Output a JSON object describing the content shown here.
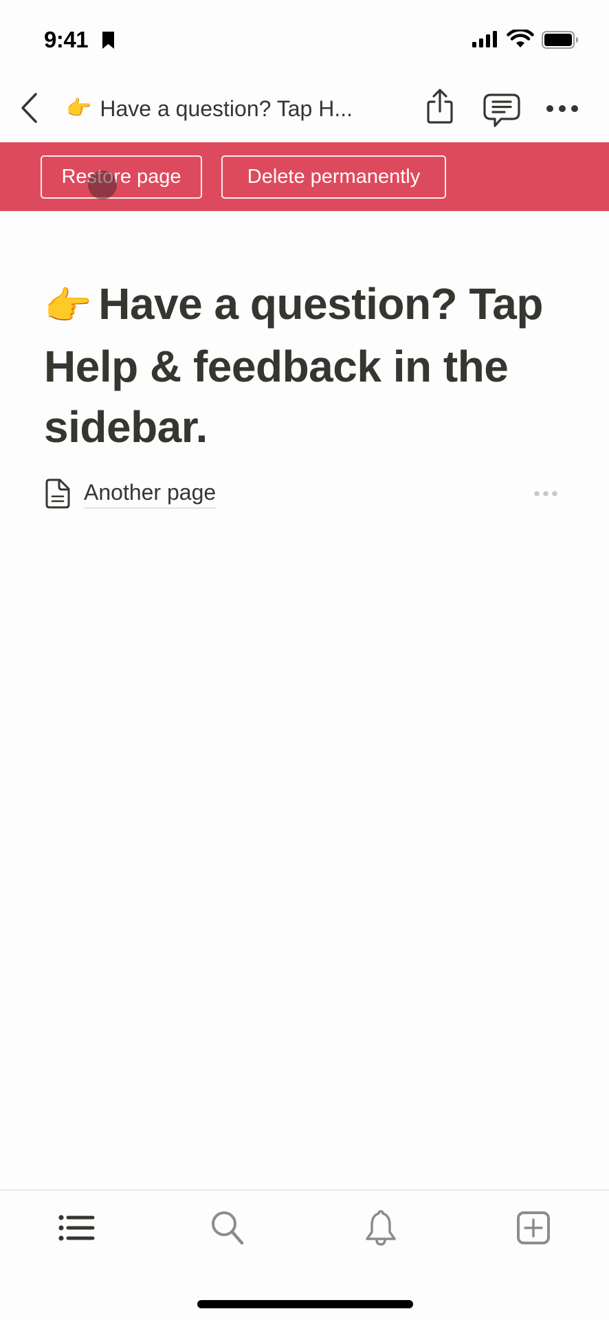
{
  "status_bar": {
    "time": "9:41",
    "icons": [
      "bookmark-icon",
      "cellular-signal-icon",
      "wifi-icon",
      "battery-icon"
    ]
  },
  "nav": {
    "back_icon": "chevron-left-icon",
    "page_emoji": "👉",
    "page_title_truncated": "Have a question? Tap H...",
    "actions": [
      "share-icon",
      "comment-icon",
      "more-horizontal-icon"
    ]
  },
  "trash_banner": {
    "background_color": "#de4a5d",
    "restore_label": "Restore page",
    "delete_label": "Delete permanently"
  },
  "page": {
    "emoji": "👉",
    "title": "Have a question? Tap Help & feedback in the sidebar.",
    "blocks": [
      {
        "type": "page-link",
        "icon": "document-icon",
        "label": "Another page"
      }
    ]
  },
  "tab_bar": {
    "tabs": [
      {
        "name": "sidebar",
        "icon": "list-icon"
      },
      {
        "name": "search",
        "icon": "search-icon"
      },
      {
        "name": "updates",
        "icon": "bell-icon"
      },
      {
        "name": "new-page",
        "icon": "new-page-icon"
      }
    ]
  }
}
